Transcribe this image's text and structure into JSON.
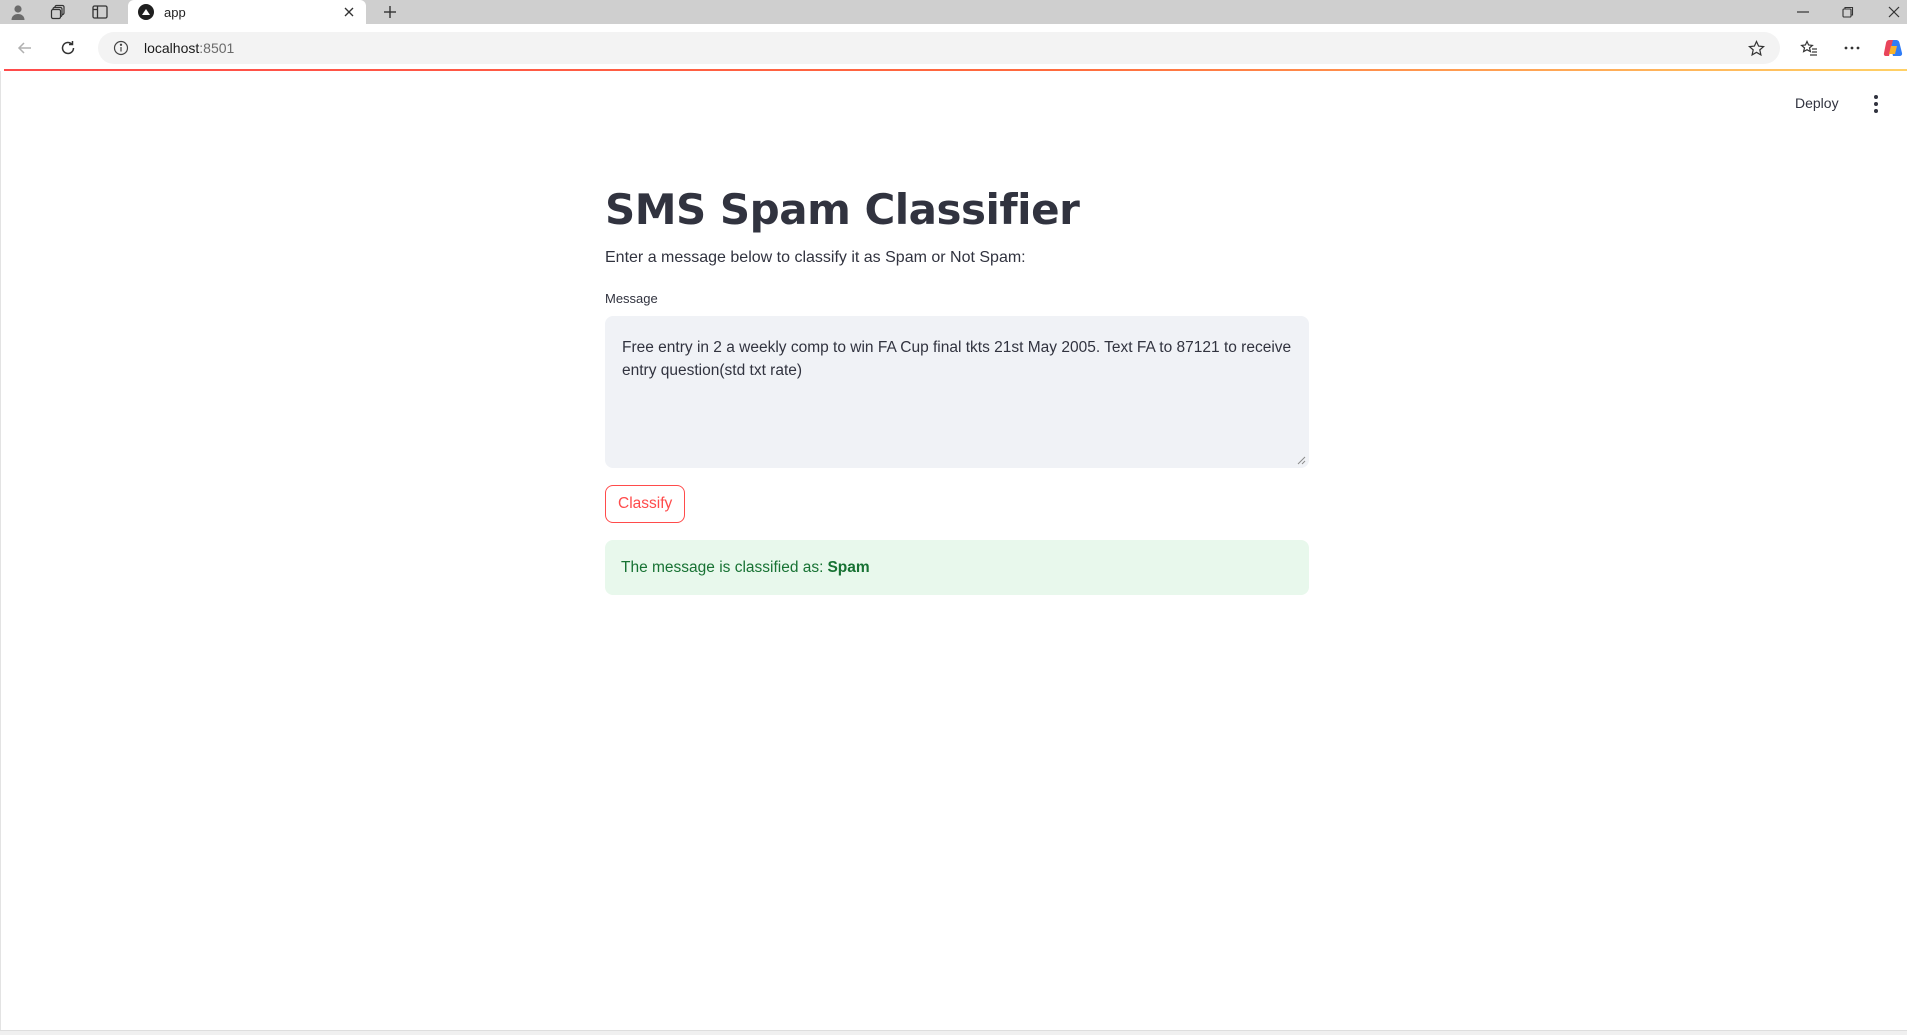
{
  "browser": {
    "tab_title": "app",
    "url_host": "localhost",
    "url_port": ":8501"
  },
  "header": {
    "deploy_label": "Deploy"
  },
  "main": {
    "title": "SMS Spam Classifier",
    "subtitle": "Enter a message below to classify it as Spam or Not Spam:",
    "message_label": "Message",
    "message_value": "Free entry in 2 a weekly comp to win FA Cup final tkts 21st May 2005. Text FA to 87121 to receive entry question(std txt rate)",
    "classify_label": "Classify",
    "result_prefix": "The message is classified as:",
    "result_value": "Spam"
  },
  "colors": {
    "accent": "#ff4b4b",
    "success_bg": "#e8f8ec",
    "success_text": "#177233",
    "text": "#31333f"
  },
  "icons": [
    "profile-icon",
    "workspaces-icon",
    "tab-actions-icon",
    "streamlit-favicon",
    "close-icon",
    "plus-icon",
    "minimize-icon",
    "restore-icon",
    "window-close-icon",
    "back-icon",
    "refresh-icon",
    "info-icon",
    "star-icon",
    "favorites-icon",
    "more-icon",
    "copilot-icon",
    "kebab-menu-icon"
  ]
}
